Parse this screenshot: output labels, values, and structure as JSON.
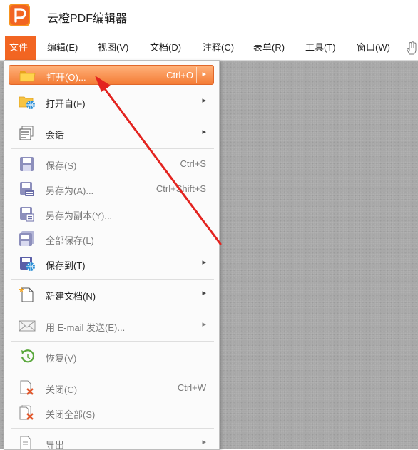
{
  "app": {
    "title": "云橙PDF编辑器",
    "accent": "#f26522"
  },
  "menubar": {
    "items": [
      "文件",
      "编辑(E)",
      "视图(V)",
      "文档(D)",
      "注释(C)",
      "表单(R)",
      "工具(T)",
      "窗口(W)"
    ]
  },
  "file_menu": {
    "open": {
      "label": "打开(O)...",
      "shortcut": "Ctrl+O",
      "icon": "folder-open-icon"
    },
    "open_from": {
      "label": "打开自(F)",
      "icon": "folder-globe-icon"
    },
    "session": {
      "label": "会话",
      "icon": "session-icon"
    },
    "save": {
      "label": "保存(S)",
      "shortcut": "Ctrl+S",
      "icon": "save-icon"
    },
    "save_as": {
      "label": "另存为(A)...",
      "shortcut": "Ctrl+Shift+S",
      "icon": "save-as-icon"
    },
    "save_copy": {
      "label": "另存为副本(Y)...",
      "icon": "save-copy-icon"
    },
    "save_all": {
      "label": "全部保存(L)",
      "icon": "save-all-icon"
    },
    "save_to": {
      "label": "保存到(T)",
      "icon": "save-to-icon"
    },
    "new_doc": {
      "label": "新建文档(N)",
      "icon": "new-document-icon"
    },
    "email": {
      "label": "用 E-mail 发送(E)...",
      "icon": "email-icon"
    },
    "restore": {
      "label": "恢复(V)",
      "icon": "restore-icon"
    },
    "close": {
      "label": "关闭(C)",
      "shortcut": "Ctrl+W",
      "icon": "close-doc-icon"
    },
    "close_all": {
      "label": "关闭全部(S)",
      "icon": "close-all-icon"
    },
    "export": {
      "label": "导出",
      "icon": "export-icon"
    },
    "submenu_glyph": "▸"
  }
}
